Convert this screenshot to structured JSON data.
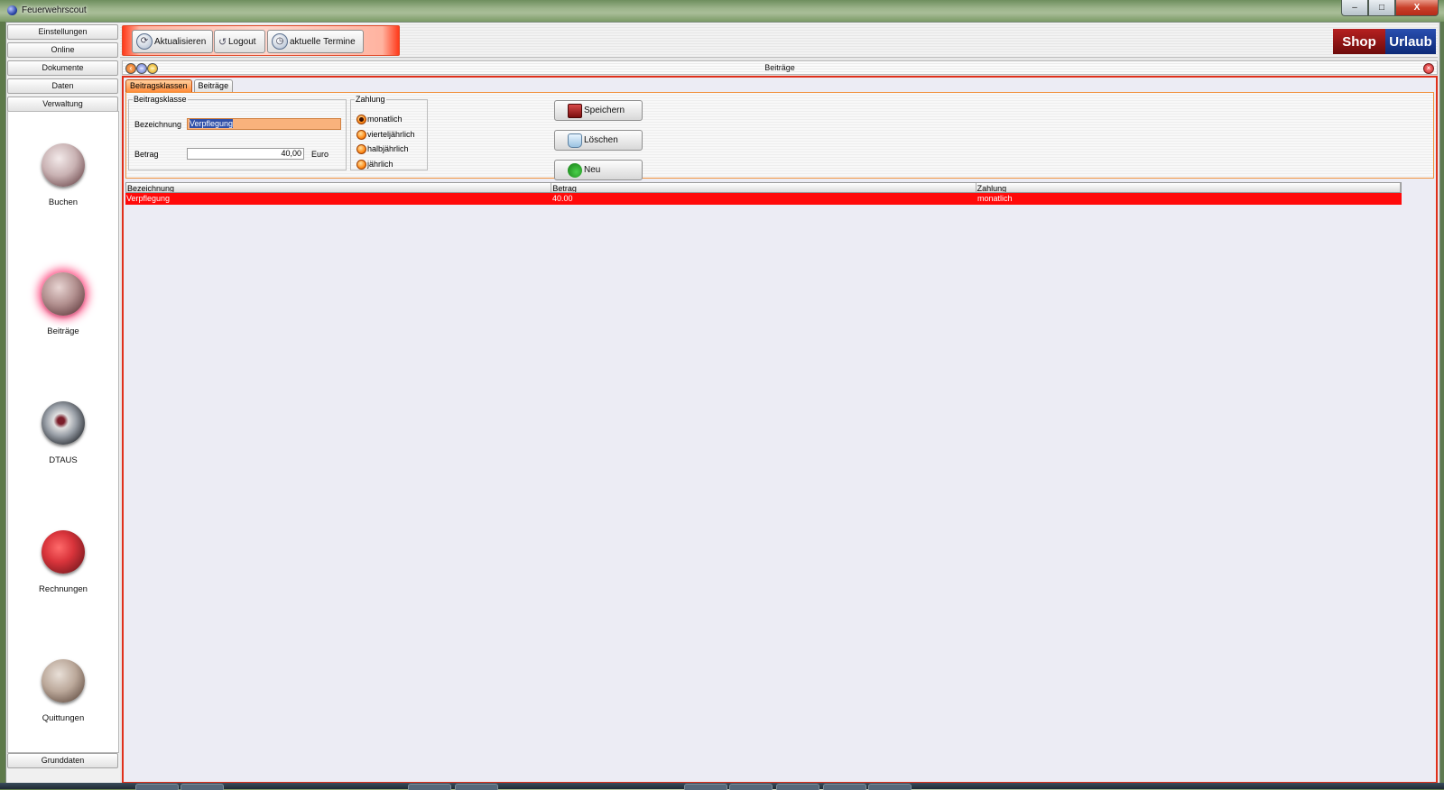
{
  "window": {
    "title": "Feuerwehrscout",
    "buttons": {
      "minimize": "–",
      "maximize": "□",
      "close": "X"
    }
  },
  "sidebar": {
    "top_buttons": [
      "Einstellungen",
      "Online",
      "Dokumente",
      "Daten",
      "Verwaltung"
    ],
    "modules": [
      {
        "label": "Buchen",
        "icon": "book-disc-icon"
      },
      {
        "label": "Beiträge",
        "icon": "contribution-disc-icon",
        "active": true
      },
      {
        "label": "DTAUS",
        "icon": "cd-disc-icon"
      },
      {
        "label": "Rechnungen",
        "icon": "invoice-disc-icon"
      },
      {
        "label": "Quittungen",
        "icon": "receipt-disc-icon"
      }
    ],
    "bottom_button": "Grunddaten"
  },
  "toolbar": {
    "refresh": "Aktualisieren",
    "logout": "Logout",
    "appointments": "aktuelle Termine"
  },
  "logo": {
    "shop": "Shop",
    "urlaub": "Urlaub"
  },
  "child_window": {
    "title": "Beiträge"
  },
  "tabs": [
    {
      "label": "Beitragsklassen",
      "active": true
    },
    {
      "label": "Beiträge",
      "active": false
    }
  ],
  "form": {
    "group_title": "Beitragsklasse",
    "name_label": "Bezeichnung",
    "name_value": "Verpflegung",
    "amount_label": "Betrag",
    "amount_value": "40,00",
    "currency": "Euro",
    "payment_title": "Zahlung",
    "payment_options": [
      {
        "label": "monatlich",
        "checked": true
      },
      {
        "label": "vierteljährlich",
        "checked": false
      },
      {
        "label": "halbjährlich",
        "checked": false
      },
      {
        "label": "jährlich",
        "checked": false
      }
    ]
  },
  "actions": {
    "save": "Speichern",
    "delete": "Löschen",
    "new": "Neu"
  },
  "table": {
    "headers": [
      "Bezeichnung",
      "Betrag",
      "Zahlung"
    ],
    "rows": [
      [
        "Verpflegung",
        "40.00",
        "monatlich"
      ]
    ]
  },
  "colors": {
    "accent": "#e0301b",
    "selection": "#ff0a0a",
    "field_highlight": "#f9b27c"
  }
}
